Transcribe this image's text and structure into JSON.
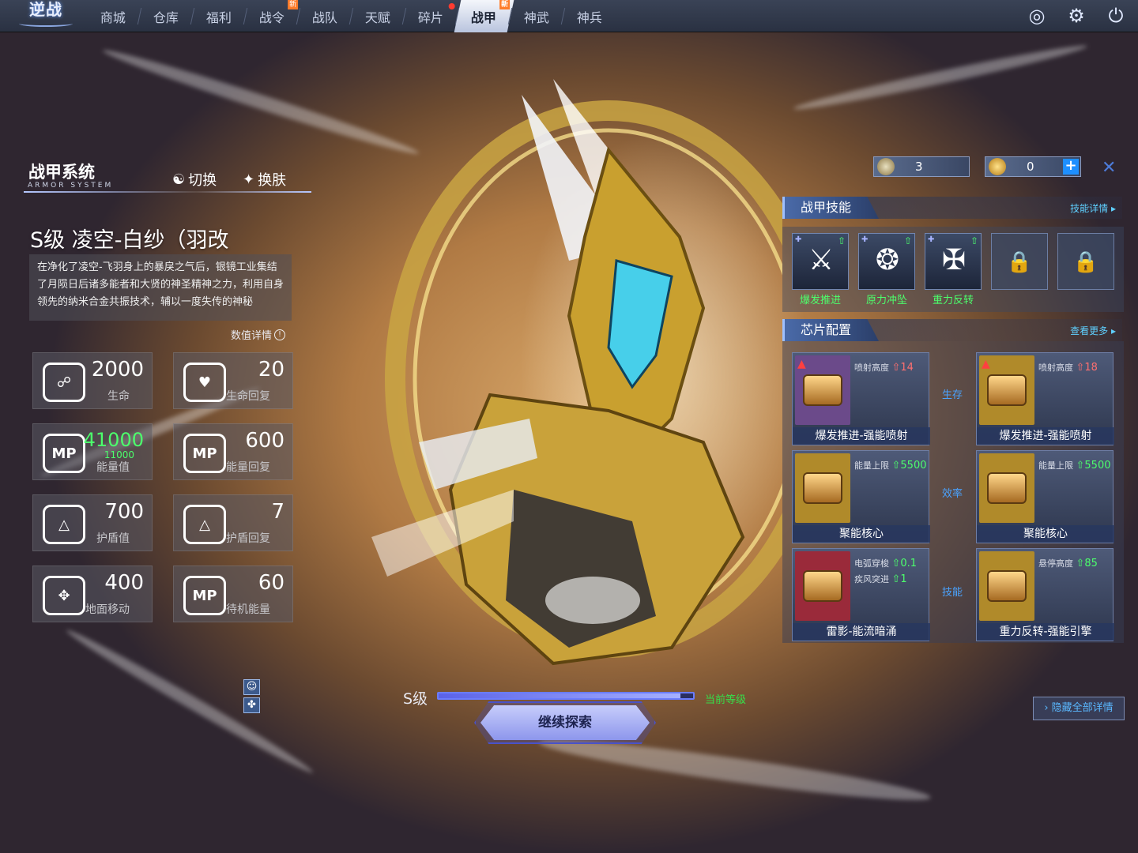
{
  "logo": "逆战",
  "nav": [
    {
      "label": "商城",
      "new": false,
      "dot": false
    },
    {
      "label": "仓库",
      "new": false,
      "dot": false
    },
    {
      "label": "福利",
      "new": false,
      "dot": false
    },
    {
      "label": "战令",
      "new": true,
      "dot": false
    },
    {
      "label": "战队",
      "new": false,
      "dot": false
    },
    {
      "label": "天赋",
      "new": false,
      "dot": false
    },
    {
      "label": "碎片",
      "new": false,
      "dot": true
    },
    {
      "label": "战甲",
      "new": true,
      "dot": false,
      "active": true
    },
    {
      "label": "神武",
      "new": false,
      "dot": false
    },
    {
      "label": "神兵",
      "new": false,
      "dot": false
    }
  ],
  "new_badge": "新",
  "top_icons": [
    "radar-icon",
    "gear-icon",
    "power-icon"
  ],
  "system": {
    "title": "战甲系统",
    "subtitle": "ARMOR SYSTEM",
    "switch_label": "切换",
    "skin_label": "换肤"
  },
  "armor": {
    "name": "S级 凌空-白纱（羽改",
    "description": "在净化了凌空-飞羽身上的暴戾之气后，银镜工业集结了月陨日后诸多能者和大贤的神圣精神之力，利用自身领先的纳米合金共振技术，辅以一度失传的神秘",
    "detail_link": "数值详情"
  },
  "stats": [
    {
      "value": "2000",
      "label": "生命",
      "icon": "armor-heart-icon"
    },
    {
      "value": "20",
      "label": "生命回复",
      "icon": "heart-regen-icon"
    },
    {
      "value": "41000",
      "sub": "11000",
      "label": "能量值",
      "icon": "mp-icon"
    },
    {
      "value": "600",
      "label": "能量回复",
      "icon": "mp-regen-icon"
    },
    {
      "value": "700",
      "label": "护盾值",
      "icon": "shield-icon"
    },
    {
      "value": "7",
      "label": "护盾回复",
      "icon": "shield-regen-icon"
    },
    {
      "value": "400",
      "label": "地面移动",
      "icon": "move-icon"
    },
    {
      "value": "60",
      "label": "待机能量",
      "icon": "idle-mp-icon"
    }
  ],
  "currency": [
    {
      "value": "3",
      "icon": "silver-coin-icon"
    },
    {
      "value": "0",
      "icon": "gold-coin-icon"
    }
  ],
  "skills_section": {
    "title": "战甲技能",
    "more": "技能详情"
  },
  "skills": [
    {
      "name": "爆发推进",
      "icon": "boost-icon"
    },
    {
      "name": "原力冲坠",
      "icon": "slam-icon"
    },
    {
      "name": "重力反转",
      "icon": "gravity-icon"
    }
  ],
  "locked_slots": 2,
  "chips_section": {
    "title": "芯片配置",
    "more": "查看更多"
  },
  "chip_categories": [
    "生存",
    "效率",
    "技能"
  ],
  "chips": [
    {
      "name": "爆发推进-强能喷射",
      "attrs": [
        {
          "label": "喷射高度",
          "value": "14",
          "color": "red"
        }
      ],
      "bg": "#6b4a8a",
      "warn": true
    },
    {
      "name": "爆发推进-强能喷射",
      "attrs": [
        {
          "label": "喷射高度",
          "value": "18",
          "color": "red"
        }
      ],
      "bg": "#b08a2a",
      "warn": true
    },
    {
      "name": "聚能核心",
      "attrs": [
        {
          "label": "能量上限",
          "value": "5500",
          "color": "green"
        }
      ],
      "bg": "#b08a2a",
      "warn": false
    },
    {
      "name": "聚能核心",
      "attrs": [
        {
          "label": "能量上限",
          "value": "5500",
          "color": "green"
        }
      ],
      "bg": "#b08a2a",
      "warn": false
    },
    {
      "name": "雷影-能流暗涌",
      "attrs": [
        {
          "label": "电弧穿梭",
          "value": "0.1",
          "color": "green"
        },
        {
          "label": "疾风突进",
          "value": "1",
          "color": "green"
        }
      ],
      "bg": "#9a2a3a",
      "warn": false
    },
    {
      "name": "重力反转-强能引擎",
      "attrs": [
        {
          "label": "悬停高度",
          "value": "85",
          "color": "green"
        }
      ],
      "bg": "#b08a2a",
      "warn": false
    }
  ],
  "bottom": {
    "grade": "S级",
    "current_level": "当前等级",
    "explore": "继续探索",
    "hide_details": "隐藏全部详情",
    "progress": 0.95
  }
}
